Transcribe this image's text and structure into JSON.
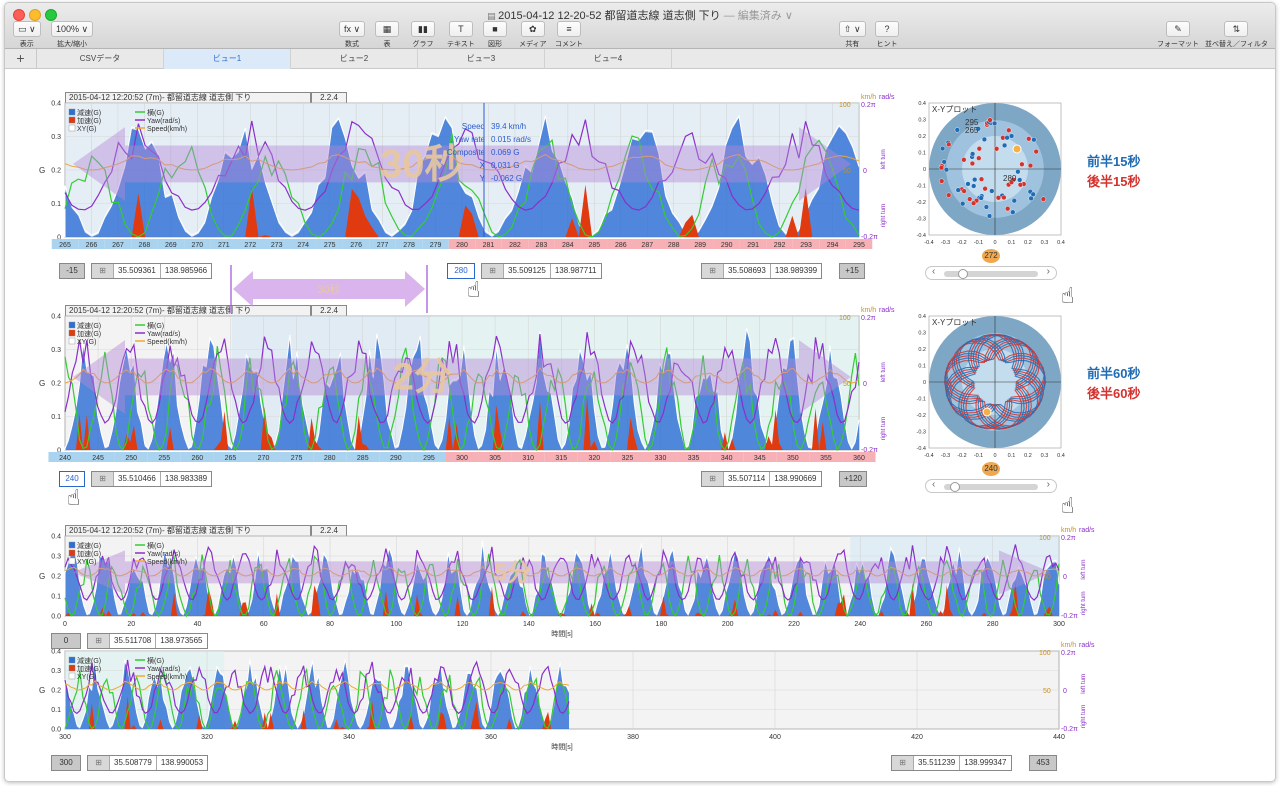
{
  "window": {
    "title": "2015-04-12 12-20-52 都留道志線 道志側 下り",
    "edited": "— 編集済み ∨"
  },
  "toolbar": {
    "left": [
      {
        "label": "表示",
        "glyph": "▭ ∨",
        "icon": "sidebar-icon"
      },
      {
        "label": "拡大/縮小",
        "glyph": "100% ∨",
        "icon": "zoom-icon"
      }
    ],
    "center": [
      {
        "label": "数式",
        "glyph": "fx ∨",
        "icon": "function-icon"
      },
      {
        "label": "表",
        "glyph": "▦",
        "icon": "table-icon"
      },
      {
        "label": "グラフ",
        "glyph": "▮▮",
        "icon": "chart-icon"
      },
      {
        "label": "テキスト",
        "glyph": "T",
        "icon": "text-icon"
      },
      {
        "label": "図形",
        "glyph": "■",
        "icon": "shape-icon"
      },
      {
        "label": "メディア",
        "glyph": "✿",
        "icon": "media-icon"
      },
      {
        "label": "コメント",
        "glyph": "≡",
        "icon": "comment-icon"
      }
    ],
    "right": [
      {
        "label": "共有",
        "glyph": "⇧ ∨",
        "icon": "share-icon"
      },
      {
        "label": "ヒント",
        "glyph": "?",
        "icon": "tips-icon"
      }
    ],
    "far_right": [
      {
        "label": "フォーマット",
        "glyph": "✎",
        "icon": "format-icon"
      },
      {
        "label": "並べ替え／フィルタ",
        "glyph": "⇅",
        "icon": "sort-filter-icon"
      }
    ]
  },
  "tabs": [
    "CSVデータ",
    "ビュー1",
    "ビュー2",
    "ビュー3",
    "ビュー4"
  ],
  "active_tab": 1,
  "colors": {
    "decel": "#2e6fd6",
    "accel": "#e03a10",
    "lateral": "#33cc33",
    "yaw": "#8b2fc9",
    "speed": "#f0a830",
    "first_half": "#1f6cb5",
    "second_half": "#d4322e",
    "time_blue": "#a9d3ee",
    "time_pink": "#f6b0b6"
  },
  "legend": {
    "decel": "減速(G)",
    "accel": "加速(G)",
    "xy": "XY(G)",
    "lateral": "横(G)",
    "yaw": "Yaw(rad/s)",
    "speed": "Speed(km/h)"
  },
  "axes": {
    "g_label": "G",
    "kmh": "km/h",
    "rads": "rad/s",
    "rad_top": "0.2π",
    "rad_mid": "0",
    "rad_bottom": "-0.2π",
    "kmh_top": "100",
    "kmh_mid": "50",
    "kmh_bottom": "0",
    "left_turn": "left turn",
    "right_turn": "right turn",
    "time": "時間[s]",
    "g_ticks": [
      "0",
      "0.1",
      "0.2",
      "0.3",
      "0.4"
    ],
    "g_ticks_fine": [
      "0.0",
      "0.1",
      "0.2",
      "0.3",
      "0.4"
    ]
  },
  "chart1": {
    "header": "2015-04-12 12:20:52 (7m)- 都留道志線 道志側 下り",
    "version": "2.2.4",
    "overlay": "30秒",
    "readout": {
      "speed_label": "Speed",
      "speed": "39.4 km/h",
      "yaw_label": "Yaw rate",
      "yaw": "0.015 rad/s",
      "comp_label": "Composite",
      "comp": "0.069 G",
      "x_label": "X",
      "x": "0.031 G",
      "y_label": "Y",
      "y": "-0.062 G"
    },
    "ticks": [
      "265",
      "266",
      "267",
      "268",
      "269",
      "270",
      "271",
      "272",
      "273",
      "274",
      "275",
      "276",
      "277",
      "278",
      "279",
      "280",
      "281",
      "282",
      "283",
      "284",
      "285",
      "286",
      "287",
      "288",
      "289",
      "290",
      "291",
      "292",
      "293",
      "294",
      "295"
    ],
    "left_step": "-15",
    "left_coord": [
      "35.509361",
      "138.985966"
    ],
    "mid_sel": "280",
    "mid_coord": [
      "35.509125",
      "138.987711"
    ],
    "right_coord": [
      "35.508693",
      "138.989399"
    ],
    "right_step": "+15",
    "drag_label": "30秒"
  },
  "chart2": {
    "header": "2015-04-12 12:20:52 (7m)- 都留道志線 道志側 下り",
    "version": "2.2.4",
    "overlay": "2分",
    "ticks": [
      "240",
      "245",
      "250",
      "255",
      "260",
      "265",
      "270",
      "275",
      "280",
      "285",
      "290",
      "295",
      "300",
      "305",
      "310",
      "315",
      "320",
      "325",
      "330",
      "335",
      "340",
      "345",
      "350",
      "355",
      "360"
    ],
    "left_sel": "240",
    "left_coord": [
      "35.510466",
      "138.983389"
    ],
    "right_coord": [
      "35.507114",
      "138.990669"
    ],
    "right_step": "+120"
  },
  "chart3": {
    "header": "2015-04-12 12:20:52 (7m)- 都留道志線 道志側 下り",
    "version": "2.2.4",
    "overlay": "5分",
    "ticks": [
      "0",
      "20",
      "40",
      "60",
      "80",
      "100",
      "120",
      "140",
      "160",
      "180",
      "200",
      "220",
      "240",
      "260",
      "280",
      "300"
    ],
    "left_step": "0",
    "left_coord": [
      "35.511708",
      "138.973565"
    ]
  },
  "chart4": {
    "ticks": [
      "300",
      "320",
      "340",
      "360",
      "380",
      "400",
      "420",
      "440"
    ],
    "left_step": "300",
    "left_coord": [
      "35.508779",
      "138.990053"
    ],
    "right_coord": [
      "35.511239",
      "138.999347"
    ],
    "right_step": "453"
  },
  "xy1": {
    "title": "X-Yプロット",
    "ticks": [
      "-0.4",
      "-0.3",
      "-0.2",
      "-0.1",
      "0",
      "0.1",
      "0.2",
      "0.3",
      "0.4"
    ],
    "yticks": [
      "0.4",
      "0.3",
      "0.2",
      "0.1",
      "0",
      "-0.1",
      "-0.2",
      "-0.3",
      "-0.4"
    ],
    "labels": [
      "295",
      "265",
      "280"
    ],
    "badge": "272",
    "note_first": "前半15秒",
    "note_second": "後半15秒"
  },
  "xy2": {
    "title": "X-Yプロット",
    "ticks": [
      "-0.4",
      "-0.3",
      "-0.2",
      "-0.1",
      "0",
      "0.1",
      "0.2",
      "0.3",
      "0.4"
    ],
    "yticks": [
      "0.4",
      "0.3",
      "0.2",
      "0.1",
      "0",
      "-0.1",
      "-0.2",
      "-0.3",
      "-0.4"
    ],
    "badge": "240",
    "note_first": "前半60秒",
    "note_second": "後半60秒"
  }
}
